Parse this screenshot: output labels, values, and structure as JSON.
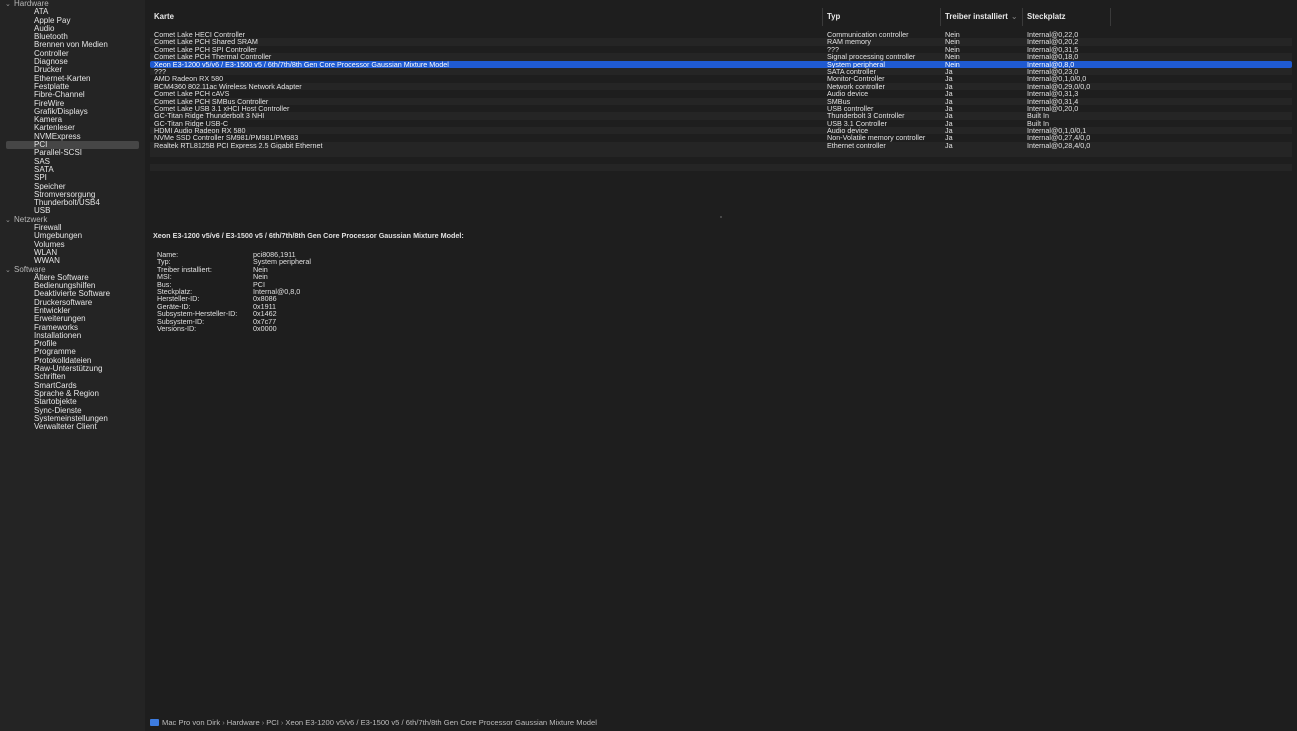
{
  "sidebar": {
    "sections": [
      {
        "label": "Hardware",
        "items": [
          "ATA",
          "Apple Pay",
          "Audio",
          "Bluetooth",
          "Brennen von Medien",
          "Controller",
          "Diagnose",
          "Drucker",
          "Ethernet-Karten",
          "Festplatte",
          "Fibre-Channel",
          "FireWire",
          "Grafik/Displays",
          "Kamera",
          "Kartenleser",
          "NVMExpress",
          "PCI",
          "Parallel-SCSI",
          "SAS",
          "SATA",
          "SPI",
          "Speicher",
          "Stromversorgung",
          "Thunderbolt/USB4",
          "USB"
        ]
      },
      {
        "label": "Netzwerk",
        "items": [
          "Firewall",
          "Umgebungen",
          "Volumes",
          "WLAN",
          "WWAN"
        ]
      },
      {
        "label": "Software",
        "items": [
          "Ältere Software",
          "Bedienungshilfen",
          "Deaktivierte Software",
          "Druckersoftware",
          "Entwickler",
          "Erweiterungen",
          "Frameworks",
          "Installationen",
          "Profile",
          "Programme",
          "Protokolldateien",
          "Raw-Unterstützung",
          "Schriften",
          "SmartCards",
          "Sprache & Region",
          "Startobjekte",
          "Sync-Dienste",
          "Systemeinstellungen",
          "Verwalteter Client"
        ]
      }
    ],
    "selected": "PCI"
  },
  "table": {
    "columns": [
      "Karte",
      "Typ",
      "Treiber installiert",
      "Steckplatz"
    ],
    "rows": [
      [
        "Comet Lake HECI Controller",
        "Communication controller",
        "Nein",
        "Internal@0,22,0"
      ],
      [
        "Comet Lake PCH Shared SRAM",
        "RAM memory",
        "Nein",
        "Internal@0,20,2"
      ],
      [
        "Comet Lake PCH SPI Controller",
        "???",
        "Nein",
        "Internal@0,31,5"
      ],
      [
        "Comet Lake PCH Thermal Controller",
        "Signal processing controller",
        "Nein",
        "Internal@0,18,0"
      ],
      [
        "Xeon E3-1200 v5/v6 / E3-1500 v5 / 6th/7th/8th Gen Core Processor Gaussian Mixture Model",
        "System peripheral",
        "Nein",
        "Internal@0,8,0"
      ],
      [
        "???",
        "SATA controller",
        "Ja",
        "Internal@0,23,0"
      ],
      [
        "AMD Radeon RX 580",
        "Monitor-Controller",
        "Ja",
        "Internal@0,1,0/0,0"
      ],
      [
        "BCM4360 802.11ac Wireless Network Adapter",
        "Network controller",
        "Ja",
        "Internal@0,29,0/0,0"
      ],
      [
        "Comet Lake PCH cAVS",
        "Audio device",
        "Ja",
        "Internal@0,31,3"
      ],
      [
        "Comet Lake PCH SMBus Controller",
        "SMBus",
        "Ja",
        "Internal@0,31,4"
      ],
      [
        "Comet Lake USB 3.1 xHCI Host Controller",
        "USB controller",
        "Ja",
        "Internal@0,20,0"
      ],
      [
        "GC-Titan Ridge Thunderbolt 3 NHI",
        "Thunderbolt 3 Controller",
        "Ja",
        "Built In"
      ],
      [
        "GC-Titan Ridge USB-C",
        "USB 3.1 Controller",
        "Ja",
        "Built In"
      ],
      [
        "HDMI Audio Radeon RX 580",
        "Audio device",
        "Ja",
        "Internal@0,1,0/0,1"
      ],
      [
        "NVMe SSD Controller SM981/PM981/PM983",
        "Non-Volatile memory controller",
        "Ja",
        "Internal@0,27,4/0,0"
      ],
      [
        "Realtek RTL8125B PCI Express 2.5 Gigabit Ethernet",
        "Ethernet controller",
        "Ja",
        "Internal@0,28,4/0,0"
      ]
    ],
    "selected_index": 4
  },
  "detail": {
    "title": "Xeon E3-1200 v5/v6 / E3-1500 v5 / 6th/7th/8th Gen Core Processor Gaussian Mixture Model:",
    "props": [
      [
        "Name:",
        "pci8086,1911"
      ],
      [
        "Typ:",
        "System peripheral"
      ],
      [
        "Treiber installiert:",
        "Nein"
      ],
      [
        "MSI:",
        "Nein"
      ],
      [
        "Bus:",
        "PCI"
      ],
      [
        "Steckplatz:",
        "Internal@0,8,0"
      ],
      [
        "Hersteller-ID:",
        "0x8086"
      ],
      [
        "Geräte-ID:",
        "0x1911"
      ],
      [
        "Subsystem-Hersteller-ID:",
        "0x1462"
      ],
      [
        "Subsystem-ID:",
        "0x7c77"
      ],
      [
        "Versions-ID:",
        "0x0000"
      ]
    ]
  },
  "pathbar": {
    "crumbs": [
      "Mac Pro von Dirk",
      "Hardware",
      "PCI",
      "Xeon E3-1200 v5/v6 / E3-1500 v5 / 6th/7th/8th Gen Core Processor Gaussian Mixture Model"
    ],
    "separator": "›",
    "icon": "computer-icon"
  },
  "colors": {
    "selection": "#1f5ad1",
    "sidebar_selection": "#464646",
    "background": "#1e1e1e"
  }
}
